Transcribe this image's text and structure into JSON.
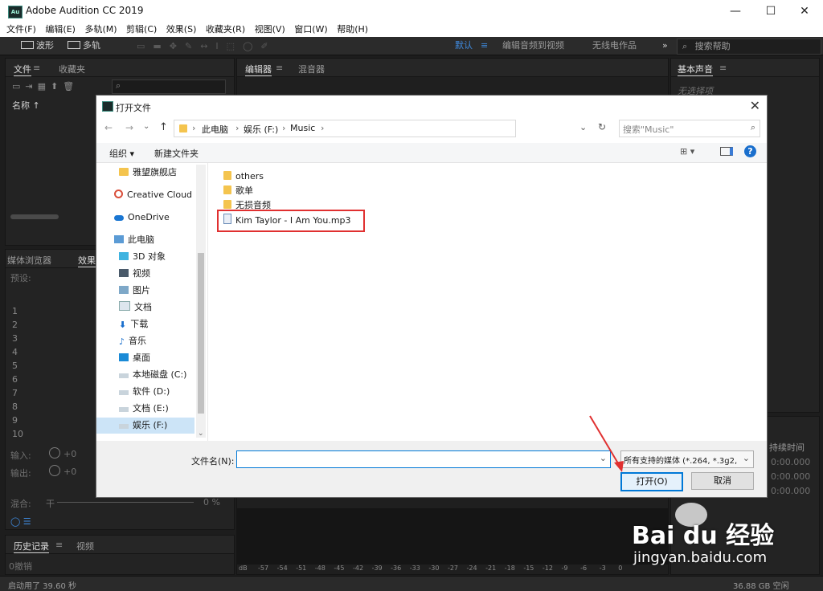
{
  "app": {
    "title": "Adobe Audition CC 2019",
    "icon_text": "Au"
  },
  "window_controls": [
    "—",
    "☐",
    "✕"
  ],
  "menu": [
    "文件(F)",
    "编辑(E)",
    "多轨(M)",
    "剪辑(C)",
    "效果(S)",
    "收藏夹(R)",
    "视图(V)",
    "窗口(W)",
    "帮助(H)"
  ],
  "toolbar": {
    "waveform": "波形",
    "multitrack": "多轨",
    "workspaces": [
      "默认",
      "编辑音频到视频",
      "无线电作品"
    ],
    "more": "»",
    "help_search": "搜索帮助"
  },
  "panels": {
    "files": {
      "tabs": [
        "文件",
        "收藏夹"
      ],
      "column": "名称 ↑"
    },
    "editor": {
      "tabs": [
        "编辑器",
        "混音器"
      ]
    },
    "essential_sound": {
      "tab": "基本声音",
      "empty": "无选择项"
    },
    "media": {
      "tabs": [
        "媒体浏览器",
        "效果组"
      ],
      "preset": "预设:"
    },
    "rack_rows": [
      "1",
      "2",
      "3",
      "4",
      "5",
      "6",
      "7",
      "8",
      "9",
      "10"
    ],
    "input": "输入:",
    "output": "输出:",
    "mix": "混合:",
    "mix_dry": "干",
    "mix_pct": "0 %",
    "io_value": "+0",
    "history": {
      "tabs": [
        "历史记录",
        "视频"
      ],
      "undo": "0撤销"
    },
    "selection": {
      "header": "持续时间",
      "values": [
        "0:00.000",
        "0:00.000",
        "0:00.000"
      ]
    },
    "ruler": [
      "dB",
      "-57",
      "-54",
      "-51",
      "-48",
      "-45",
      "-42",
      "-39",
      "-36",
      "-33",
      "-30",
      "-27",
      "-24",
      "-21",
      "-18",
      "-15",
      "-12",
      "-9",
      "-6",
      "-3",
      "0"
    ]
  },
  "status": {
    "left": "启动用了 39.60 秒",
    "right": "36.88 GB 空闲"
  },
  "dialog": {
    "title": "打开文件",
    "breadcrumb": [
      "此电脑",
      "娱乐 (F:)",
      "Music"
    ],
    "search_placeholder": "搜索\"Music\"",
    "organize": "组织 ▾",
    "new_folder": "新建文件夹",
    "nav": [
      {
        "label": "雅望旗舰店",
        "icon": "folder-icon"
      },
      {
        "label": "Creative Cloud F",
        "icon": "creative-cloud-icon"
      },
      {
        "label": "OneDrive",
        "icon": "onedrive-icon"
      },
      {
        "label": "此电脑",
        "icon": "computer-icon"
      },
      {
        "label": "3D 对象",
        "icon": "cube-icon"
      },
      {
        "label": "视频",
        "icon": "video-icon"
      },
      {
        "label": "图片",
        "icon": "picture-icon"
      },
      {
        "label": "文档",
        "icon": "document-icon"
      },
      {
        "label": "下载",
        "icon": "download-icon"
      },
      {
        "label": "音乐",
        "icon": "music-icon"
      },
      {
        "label": "桌面",
        "icon": "desktop-icon"
      },
      {
        "label": "本地磁盘 (C:)",
        "icon": "drive-icon"
      },
      {
        "label": "软件 (D:)",
        "icon": "drive-icon"
      },
      {
        "label": "文档 (E:)",
        "icon": "drive-icon"
      },
      {
        "label": "娱乐 (F:)",
        "icon": "drive-icon"
      }
    ],
    "files": [
      {
        "name": "others",
        "type": "folder"
      },
      {
        "name": "歌单",
        "type": "folder"
      },
      {
        "name": "无损音频",
        "type": "folder"
      },
      {
        "name": "Kim Taylor - I Am You.mp3",
        "type": "mp3"
      }
    ],
    "filename_label": "文件名(N):",
    "filename_value": "",
    "filter": "所有支持的媒体 (*.264, *.3g2,",
    "open_button": "打开(O)",
    "cancel_button": "取消"
  },
  "watermark": {
    "brand": "Bai du 经验",
    "url": "jingyan.baidu.com"
  },
  "colors": {
    "accent": "#0078d7",
    "highlight": "#e03030",
    "workspace_active": "#3f8be0"
  }
}
